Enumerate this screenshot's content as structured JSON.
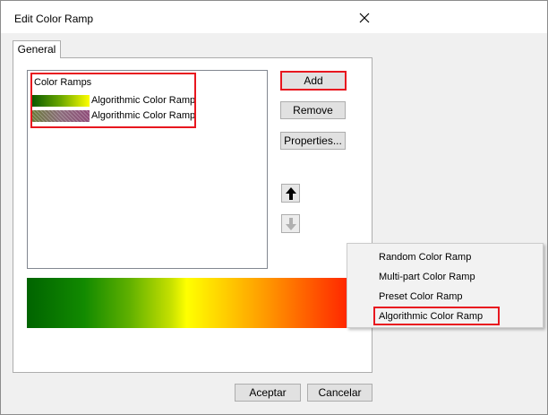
{
  "dialog": {
    "title": "Edit Color Ramp",
    "tab_general": "General"
  },
  "list": {
    "header": "Color Ramps",
    "items": [
      {
        "label": "Algorithmic Color Ramp",
        "swatch": "green-yellow gradient"
      },
      {
        "label": "Algorithmic Color Ramp",
        "swatch": "hatched olive-purple gradient"
      }
    ]
  },
  "buttons": {
    "add": "Add",
    "remove": "Remove",
    "properties": "Properties...",
    "ok": "Aceptar",
    "cancel": "Cancelar"
  },
  "icons": {
    "move_up": "arrow-up-icon",
    "move_down": "arrow-down-icon",
    "close": "close-icon"
  },
  "context_menu": {
    "items": [
      "Random Color Ramp",
      "Multi-part Color Ramp",
      "Preset Color Ramp",
      "Algorithmic Color Ramp"
    ],
    "highlighted_index": 3
  },
  "preview": {
    "colors": [
      "#006400",
      "#ffff00",
      "#ff2800"
    ]
  },
  "accent_colors": {
    "highlight_border": "#e8171f"
  }
}
